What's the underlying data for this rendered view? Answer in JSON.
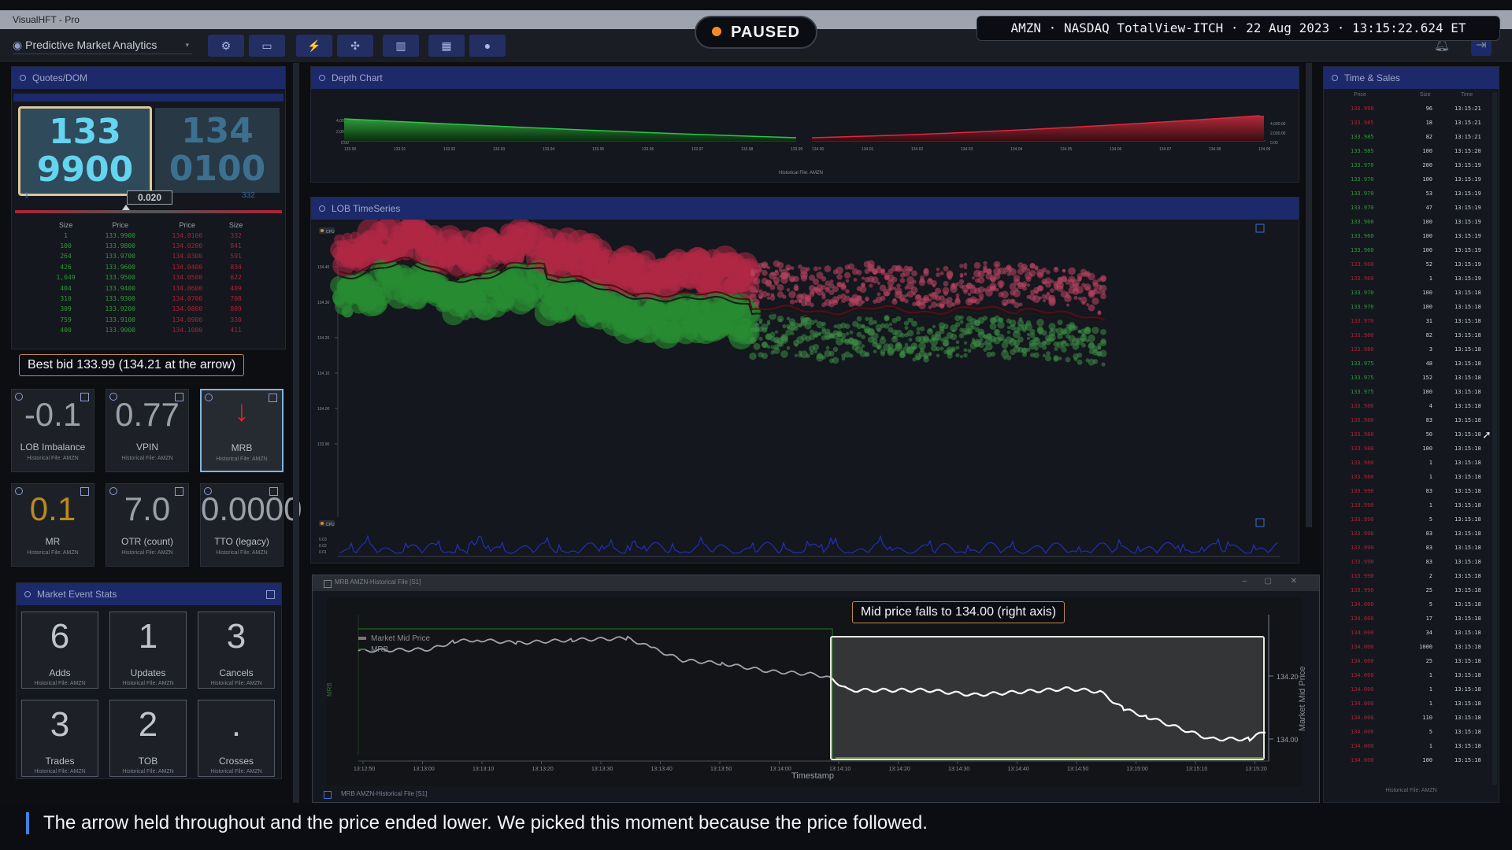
{
  "window": {
    "title": "VisualHFT - Pro"
  },
  "toolbar": {
    "app_selector": "Predictive Market Analytics",
    "buttons": [
      "settings",
      "monitor",
      "lightning",
      "plugins",
      "analytics",
      "keyboard",
      "user"
    ]
  },
  "overlay": {
    "paused_label": "PAUSED",
    "info": "AMZN · NASDAQ TotalView-ITCH · 22 Aug 2023 · 13:15:22.624 ET"
  },
  "quotes": {
    "title": "Quotes/DOM",
    "bid_line1": "133",
    "bid_line2": "9900",
    "ask_line1": "134",
    "ask_line2": "0100",
    "spread": "0.020",
    "bid_size": "1",
    "ask_size": "332",
    "headers": [
      "Size",
      "Price",
      "Price",
      "Size"
    ],
    "rows": [
      [
        "1",
        "133.9900",
        "134.0100",
        "332"
      ],
      [
        "100",
        "133.9800",
        "134.0200",
        "841"
      ],
      [
        "264",
        "133.9700",
        "134.0300",
        "591"
      ],
      [
        "426",
        "133.9600",
        "134.0400",
        "834"
      ],
      [
        "1,049",
        "133.9500",
        "134.0500",
        "622"
      ],
      [
        "404",
        "133.9400",
        "134.0600",
        "409"
      ],
      [
        "310",
        "133.9300",
        "134.0700",
        "708"
      ],
      [
        "309",
        "133.9200",
        "134.0800",
        "889"
      ],
      [
        "759",
        "133.9100",
        "134.0900",
        "330"
      ],
      [
        "400",
        "133.9000",
        "134.1000",
        "411"
      ]
    ],
    "callout": "Best bid 133.99 (134.21 at the arrow)"
  },
  "gauges": [
    {
      "value": "-0.1",
      "label": "LOB Imbalance",
      "sub": "Historical File: AMZN",
      "color": "#9aa0aa"
    },
    {
      "value": "0.77",
      "label": "VPIN",
      "sub": "Historical File: AMZN",
      "color": "#9aa0aa"
    },
    {
      "value": "↓",
      "label": "MRB",
      "sub": "Historical File: AMZN",
      "color": "#e02020"
    },
    {
      "value": "0.1",
      "label": "MR",
      "sub": "Historical File: AMZN",
      "color": "#b98a22"
    },
    {
      "value": "7.0",
      "label": "OTR (count)",
      "sub": "Historical File: AMZN",
      "color": "#9aa0aa"
    },
    {
      "value": "0.0000",
      "label": "TTO (legacy)",
      "sub": "Historical File: AMZN",
      "color": "#9aa0aa"
    }
  ],
  "market_stats": {
    "title": "Market Event Stats",
    "items": [
      {
        "value": "6",
        "label": "Adds",
        "sub": "Historical File: AMZN"
      },
      {
        "value": "1",
        "label": "Updates",
        "sub": "Historical File: AMZN"
      },
      {
        "value": "3",
        "label": "Cancels",
        "sub": "Historical File: AMZN"
      },
      {
        "value": "3",
        "label": "Trades",
        "sub": "Historical File: AMZN"
      },
      {
        "value": "2",
        "label": "TOB",
        "sub": "Historical File: AMZN"
      },
      {
        "value": ".",
        "label": "Crosses",
        "sub": "Historical File: AMZN"
      }
    ]
  },
  "depth_chart": {
    "title": "Depth Chart",
    "footer": "Historical File: AMZN",
    "y_ticks": [
      "4,000.00",
      "2,000.00",
      "0.00"
    ],
    "bid_ticks": [
      "133.90",
      "133.91",
      "133.92",
      "133.93",
      "133.94",
      "133.95",
      "133.96",
      "133.97",
      "133.98",
      "133.99"
    ],
    "ask_ticks": [
      "134.00",
      "134.01",
      "134.02",
      "134.03",
      "134.04",
      "134.05",
      "134.06",
      "134.07",
      "134.08",
      "134.09"
    ]
  },
  "lob_timeseries": {
    "title": "LOB TimeSeries",
    "cpu_label": "CPU",
    "y_ticks": [
      "134.40",
      "134.30",
      "134.20",
      "134.10",
      "134.00",
      "133.90"
    ],
    "sub_y_ticks": [
      "0.03",
      "0.02",
      "0.01"
    ]
  },
  "mrb_window": {
    "title": "MRB AMZN-Historical File [S1]",
    "footer": "MRB AMZN-Historical File [S1]",
    "legend": [
      "Market Mid Price",
      "MRB"
    ],
    "callout": "Mid price falls to 134.00 (right axis)",
    "y_left_label": "MRB",
    "y_right_label": "Market Mid Price",
    "x_label": "Timestamp",
    "x_ticks": [
      "13:12:50",
      "13:13:00",
      "13:13:10",
      "13:13:20",
      "13:13:30",
      "13:13:40",
      "13:13:50",
      "13:14:00",
      "13:14:10",
      "13:14:20",
      "13:14:30",
      "13:14:40",
      "13:14:50",
      "13:15:00",
      "13:15:10",
      "13:15:20"
    ],
    "y_right_ticks": [
      "134.20",
      "134.00"
    ]
  },
  "time_sales": {
    "title": "Time & Sales",
    "headers": [
      "Price",
      "Size",
      "Time"
    ],
    "footer": "Historical File: AMZN",
    "rows": [
      [
        "133.990",
        "96",
        "13:15:21",
        "red"
      ],
      [
        "133.985",
        "18",
        "13:15:21",
        "red"
      ],
      [
        "133.985",
        "82",
        "13:15:21",
        "green"
      ],
      [
        "133.985",
        "100",
        "13:15:20",
        "green"
      ],
      [
        "133.970",
        "200",
        "13:15:19",
        "green"
      ],
      [
        "133.970",
        "100",
        "13:15:19",
        "green"
      ],
      [
        "133.970",
        "53",
        "13:15:19",
        "green"
      ],
      [
        "133.970",
        "47",
        "13:15:19",
        "green"
      ],
      [
        "133.960",
        "100",
        "13:15:19",
        "green"
      ],
      [
        "133.960",
        "100",
        "13:15:19",
        "green"
      ],
      [
        "133.960",
        "100",
        "13:15:19",
        "green"
      ],
      [
        "133.960",
        "52",
        "13:15:19",
        "red"
      ],
      [
        "133.960",
        "1",
        "13:15:19",
        "red"
      ],
      [
        "133.970",
        "100",
        "13:15:18",
        "green"
      ],
      [
        "133.970",
        "100",
        "13:15:18",
        "green"
      ],
      [
        "133.970",
        "31",
        "13:15:18",
        "red"
      ],
      [
        "133.980",
        "82",
        "13:15:18",
        "red"
      ],
      [
        "133.980",
        "3",
        "13:15:18",
        "red"
      ],
      [
        "133.975",
        "48",
        "13:15:18",
        "green"
      ],
      [
        "133.975",
        "152",
        "13:15:18",
        "green"
      ],
      [
        "133.975",
        "100",
        "13:15:18",
        "green"
      ],
      [
        "133.980",
        "4",
        "13:15:18",
        "red"
      ],
      [
        "133.980",
        "83",
        "13:15:18",
        "red"
      ],
      [
        "133.980",
        "50",
        "13:15:18",
        "red"
      ],
      [
        "133.980",
        "100",
        "13:15:18",
        "red"
      ],
      [
        "133.980",
        "1",
        "13:15:18",
        "red"
      ],
      [
        "133.980",
        "1",
        "13:15:18",
        "red"
      ],
      [
        "133.990",
        "83",
        "13:15:18",
        "red"
      ],
      [
        "133.990",
        "1",
        "13:15:18",
        "red"
      ],
      [
        "133.990",
        "5",
        "13:15:18",
        "red"
      ],
      [
        "133.990",
        "83",
        "13:15:18",
        "red"
      ],
      [
        "133.990",
        "83",
        "13:15:18",
        "red"
      ],
      [
        "133.990",
        "83",
        "13:15:18",
        "red"
      ],
      [
        "133.990",
        "2",
        "13:15:18",
        "red"
      ],
      [
        "133.990",
        "25",
        "13:15:18",
        "red"
      ],
      [
        "134.000",
        "5",
        "13:15:18",
        "red"
      ],
      [
        "134.000",
        "17",
        "13:15:18",
        "red"
      ],
      [
        "134.000",
        "34",
        "13:15:18",
        "red"
      ],
      [
        "134.000",
        "1000",
        "13:15:18",
        "red"
      ],
      [
        "134.000",
        "25",
        "13:15:18",
        "red"
      ],
      [
        "134.000",
        "1",
        "13:15:18",
        "red"
      ],
      [
        "134.000",
        "1",
        "13:15:18",
        "red"
      ],
      [
        "134.000",
        "1",
        "13:15:18",
        "red"
      ],
      [
        "134.000",
        "110",
        "13:15:18",
        "red"
      ],
      [
        "134.000",
        "5",
        "13:15:18",
        "red"
      ],
      [
        "134.000",
        "1",
        "13:15:18",
        "red"
      ],
      [
        "134.000",
        "100",
        "13:15:18",
        "red"
      ]
    ]
  },
  "subtitle": "The arrow held throughout and the price ended lower. We picked this moment because the price followed.",
  "colors": {
    "accent": "#1c2a6b",
    "bid": "#2e9a3a",
    "ask": "#b02035",
    "highlight": "#ffffff"
  }
}
